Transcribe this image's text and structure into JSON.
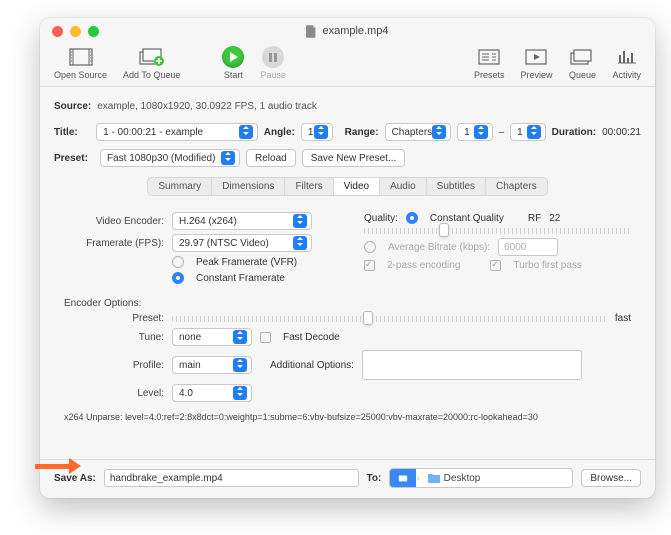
{
  "window": {
    "title": "example.mp4"
  },
  "toolbar": {
    "open_source": "Open Source",
    "add_to_queue": "Add To Queue",
    "start": "Start",
    "pause": "Pause",
    "presets": "Presets",
    "preview": "Preview",
    "queue": "Queue",
    "activity": "Activity"
  },
  "source": {
    "label": "Source:",
    "value": "example, 1080x1920, 30.0922 FPS, 1 audio track"
  },
  "title": {
    "label": "Title:",
    "value": "1 - 00:00:21 - example"
  },
  "angle": {
    "label": "Angle:",
    "value": "1"
  },
  "range": {
    "label": "Range:",
    "mode": "Chapters",
    "from": "1",
    "dash": "–",
    "to": "1"
  },
  "duration": {
    "label": "Duration:",
    "value": "00:00:21"
  },
  "preset": {
    "label": "Preset:",
    "value": "Fast 1080p30 (Modified)",
    "reload": "Reload",
    "save_new": "Save New Preset..."
  },
  "tabs": [
    "Summary",
    "Dimensions",
    "Filters",
    "Video",
    "Audio",
    "Subtitles",
    "Chapters"
  ],
  "active_tab": "Video",
  "video": {
    "encoder_label": "Video Encoder:",
    "encoder": "H.264 (x264)",
    "framerate_label": "Framerate (FPS):",
    "framerate": "29.97 (NTSC Video)",
    "peak": "Peak Framerate (VFR)",
    "constant_fr": "Constant Framerate",
    "quality_label": "Quality:",
    "constant_quality": "Constant Quality",
    "rf_label": "RF",
    "rf": "22",
    "avg_bitrate": "Average Bitrate (kbps):",
    "avg_bitrate_value": "6000",
    "two_pass": "2-pass encoding",
    "turbo": "Turbo first pass",
    "encoder_options": "Encoder Options:",
    "preset_label": "Preset:",
    "preset_hint": "fast",
    "tune_label": "Tune:",
    "tune": "none",
    "fast_decode": "Fast Decode",
    "profile_label": "Profile:",
    "profile": "main",
    "addl": "Additional Options:",
    "level_label": "Level:",
    "level": "4.0",
    "unparse_label": "x264 Unparse:",
    "unparse": "level=4.0:ref=2:8x8dct=0:weightp=1:subme=6:vbv-bufsize=25000:vbv-maxrate=20000:rc-lookahead=30"
  },
  "footer": {
    "save_as_label": "Save As:",
    "save_as": "handbrake_example.mp4",
    "to_label": "To:",
    "path_segment": "Desktop",
    "browse": "Browse..."
  }
}
